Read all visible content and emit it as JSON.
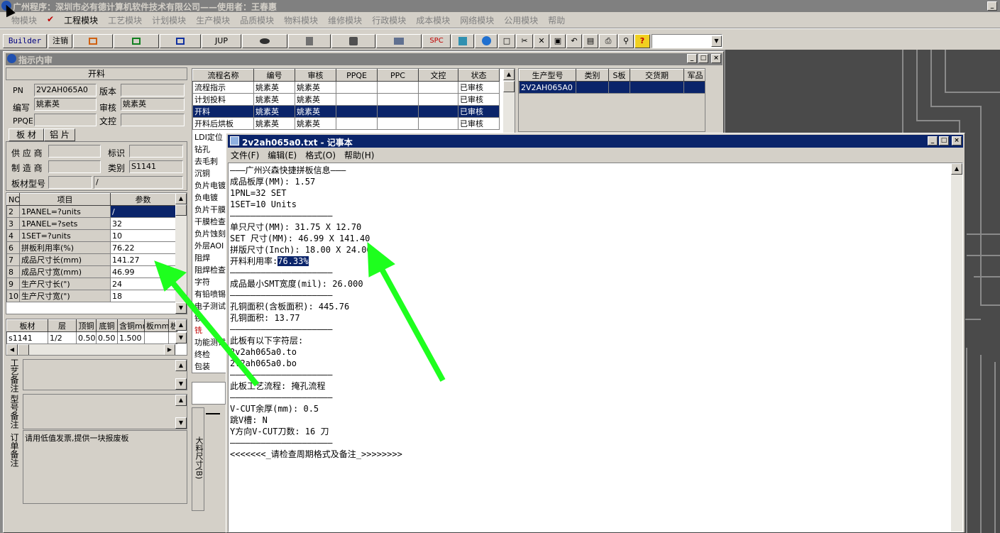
{
  "app": {
    "title": "广州程序：深圳市必有德计算机软件技术有限公司——使用者：王春惠",
    "menu": [
      "物模块",
      "工程模块",
      "工艺模块",
      "计划模块",
      "生产模块",
      "品质模块",
      "物料模块",
      "维修模块",
      "行政模块",
      "成本模块",
      "网络模块",
      "公用模块",
      "帮助"
    ],
    "toolbar": {
      "builder": "Builder",
      "logout": "注销",
      "jup": "JUP",
      "spc": "SPC"
    }
  },
  "sub": {
    "title": "指示内审",
    "header": "开料",
    "fields": {
      "pn_label": "PN",
      "pn": "2V2AH065A0",
      "ver_label": "版本",
      "ver": "",
      "writer_label": "编写",
      "writer": "姚素英",
      "audit_label": "审核",
      "audit": "姚素英",
      "ppqe_label": "PPQE",
      "ppqe": "",
      "wenkong_label": "文控",
      "wenkong": ""
    },
    "tabs": [
      "板 材",
      "铝 片"
    ],
    "mat": {
      "supplier": "供 应 商",
      "mark": "标识",
      "maker": "制 造 商",
      "cat_label": "类别",
      "cat": "S1141",
      "model_label": "板材型号",
      "model": "/"
    },
    "param_headers": [
      "NO",
      "项目",
      "参数"
    ],
    "params": [
      [
        "2",
        "1PANEL=?units",
        "/"
      ],
      [
        "3",
        "1PANEL=?sets",
        "32"
      ],
      [
        "4",
        "1SET=?units",
        "10"
      ],
      [
        "6",
        "拼板利用率(%)",
        "76.22"
      ],
      [
        "7",
        "成品尺寸长(mm)",
        "141.27"
      ],
      [
        "8",
        "成品尺寸宽(mm)",
        "46.99"
      ],
      [
        "9",
        "生产尺寸长(\")",
        "24"
      ],
      [
        "10",
        "生产尺寸宽(\")",
        "18"
      ]
    ],
    "board_headers": [
      "板材",
      "层",
      "顶铜",
      "底铜",
      "含铜mm",
      "板mm",
      "板"
    ],
    "board_row": [
      "s1141",
      "1/2",
      "0.50",
      "0.50",
      "1.500",
      "",
      ""
    ],
    "notes": [
      {
        "label": "工艺备注",
        "text": ""
      },
      {
        "label": "型号备注",
        "text": ""
      },
      {
        "label": "订单备注",
        "text": "请用低值发票,提供一块报废板"
      }
    ],
    "flow_headers": [
      "流程名称",
      "编号",
      "审核",
      "PPQE",
      "PPC",
      "文控",
      "状态"
    ],
    "flows": [
      [
        "流程指示",
        "姚素英",
        "姚素英",
        "",
        "",
        "",
        "已审核"
      ],
      [
        "计划投料",
        "姚素英",
        "姚素英",
        "",
        "",
        "",
        "已审核"
      ],
      [
        "开料",
        "姚素英",
        "姚素英",
        "",
        "",
        "",
        "已审核"
      ],
      [
        "开料后烘板",
        "姚素英",
        "姚素英",
        "",
        "",
        "",
        "已审核"
      ]
    ],
    "flow_more": [
      "LDI定位",
      "钻孔",
      "去毛刺",
      "沉铜",
      "负片电镀",
      "负电镀",
      "负片干膜",
      "干膜检查",
      "负片蚀刻",
      "外层AOI",
      "阻焊",
      "阻焊检查",
      "字符",
      "有铅喷锡",
      "电子测试",
      "锣",
      "铣",
      "功能测试",
      "终检",
      "包装"
    ],
    "prod_headers": [
      "生产型号",
      "类别",
      "S板",
      "交货期",
      "军品"
    ],
    "prod_row": [
      "2V2AH065A0",
      "",
      "",
      "",
      ""
    ],
    "vlabel": "大料尺寸(B)"
  },
  "notepad": {
    "title": "2v2ah065a0.txt - 记事本",
    "menu": [
      "文件(F)",
      "编辑(E)",
      "格式(O)",
      "帮助(H)"
    ],
    "lines": [
      "———广州兴森快捷拼板信息———",
      "成品板厚(MM): 1.57",
      "1PNL=32 SET",
      "1SET=10 Units",
      "————————————————————",
      "单只尺寸(MM): 31.75 X 12.70",
      "SET 尺寸(MM): 46.99 X 141.40",
      "拼版尺寸(Inch): 18.00 X 24.00",
      "开料利用率:",
      "————————————————————",
      "成品最小SMT宽度(mil): 26.000",
      "————————————————————",
      "孔铜面积(含板面积): 445.76",
      "孔铜面积: 13.77",
      "————————————————————",
      "此板有以下字符层:",
      "2v2ah065a0.to",
      "2v2ah065a0.bo",
      "————————————————————",
      "此板工艺流程: 掩孔流程",
      "————————————————————",
      "V-CUT余厚(mm): 0.5",
      "跳V槽: N",
      "Y方向V-CUT刀数: 16 刀",
      "————————————————————",
      "<<<<<<<_请检查周期格式及备注_>>>>>>>>"
    ],
    "highlight": "76.33%"
  },
  "colors": {
    "title_active": "#0a246a",
    "arrow": "#00ff00"
  }
}
